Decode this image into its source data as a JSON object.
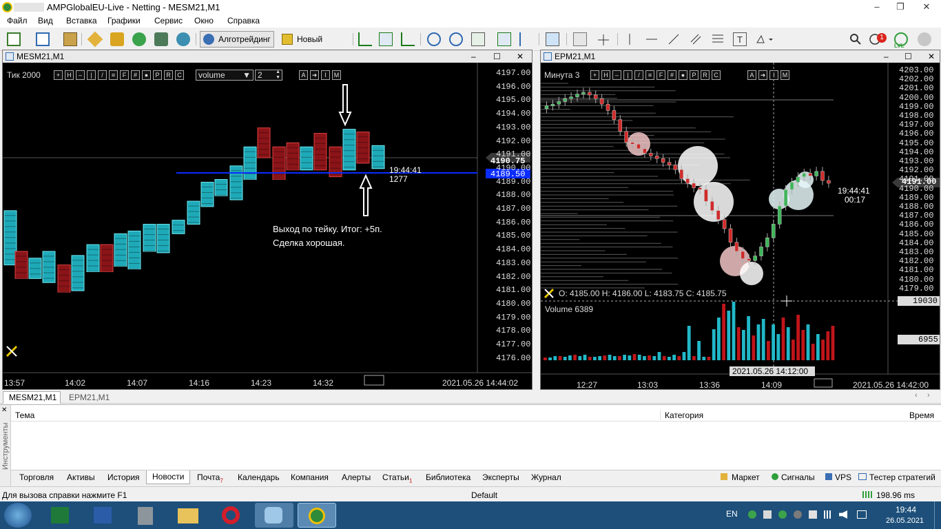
{
  "window": {
    "title": "AMPGlobalEU-Live - Netting - MESM21,M1",
    "minimize": "–",
    "restore": "❐",
    "close": "✕"
  },
  "menu": [
    "Файл",
    "Вид",
    "Вставка",
    "Графики",
    "Сервис",
    "Окно",
    "Справка"
  ],
  "toolbar": {
    "algotrading": "Алготрейдинг",
    "new_order": "Новый ордер",
    "lvl": "LVL",
    "badge": "1"
  },
  "left_chart": {
    "title": "MESM21,M1",
    "timeframe": "Тик 2000",
    "indicator": "volume",
    "param": "2",
    "tools": [
      "A",
      "➜",
      "I",
      "M"
    ],
    "price_ticks": [
      "4197.00",
      "4196.00",
      "4195.00",
      "4194.00",
      "4193.00",
      "4192.00",
      "4191.00",
      "4190.00",
      "4189.00",
      "4188.00",
      "4187.00",
      "4186.00",
      "4185.00",
      "4184.00",
      "4183.00",
      "4182.00",
      "4181.00",
      "4180.00",
      "4179.00",
      "4178.00",
      "4177.00",
      "4176.00"
    ],
    "current_price": "4190.75",
    "blue_price": "4189.50",
    "timer": "19:44:41",
    "timer_volume": "1277",
    "annotation_line1": "Выход по тейку. Итог: +5п.",
    "annotation_line2": "Сделка хорошая.",
    "time_ticks": [
      "13:57",
      "14:02",
      "14:07",
      "14:16",
      "14:23",
      "14:32"
    ],
    "datetime": "2021.05.26 14:44:02"
  },
  "right_chart": {
    "title": "EPM21,M1",
    "timeframe": "Минута 3",
    "tools": [
      "A",
      "➜",
      "I",
      "M"
    ],
    "price_ticks": [
      "4203.00",
      "4202.00",
      "4201.00",
      "4200.00",
      "4199.00",
      "4198.00",
      "4197.00",
      "4196.00",
      "4195.00",
      "4194.00",
      "4193.00",
      "4192.00",
      "4191.00",
      "4190.00",
      "4189.00",
      "4188.00",
      "4187.00",
      "4186.00",
      "4185.00",
      "4184.00",
      "4183.00",
      "4182.00",
      "4181.00",
      "4180.00",
      "4179.00"
    ],
    "current_price": "4191.00",
    "timer": "19:44:41",
    "timer_sub": "00:17",
    "ohlc": "O: 4185.00  H: 4186.00  L: 4183.75  C: 4185.75",
    "volume_label": "Volume 6389",
    "vol_ticks": [
      "19030",
      "6955"
    ],
    "crosshair_time": "2021.05.26 14:12:00",
    "time_ticks": [
      "12:27",
      "13:03",
      "13:36",
      "14:09"
    ],
    "datetime": "2021.05.26 14:42:00"
  },
  "chart_tabs": [
    "MESM21,M1",
    "EPM21,M1"
  ],
  "news_table": {
    "columns": [
      "Тема",
      "Категория",
      "Время"
    ],
    "side_label": "Инструменты"
  },
  "bottom_tabs": [
    {
      "label": "Торговля"
    },
    {
      "label": "Активы"
    },
    {
      "label": "История"
    },
    {
      "label": "Новости"
    },
    {
      "label": "Почта",
      "badge": "7"
    },
    {
      "label": "Календарь"
    },
    {
      "label": "Компания"
    },
    {
      "label": "Алерты"
    },
    {
      "label": "Статьи",
      "badge": "1"
    },
    {
      "label": "Библиотека"
    },
    {
      "label": "Эксперты"
    },
    {
      "label": "Журнал"
    }
  ],
  "bottom_right": [
    "Маркет",
    "Сигналы",
    "VPS",
    "Тестер стратегий"
  ],
  "status": {
    "help": "Для вызова справки нажмите F1",
    "profile": "Default",
    "ping": "198.96 ms"
  },
  "taskbar": {
    "lang": "EN",
    "time": "19:44",
    "date": "26.05.2021"
  },
  "colors": {
    "bull": "#21b8c8",
    "bear": "#c0151a",
    "blue_line": "#0a2cff",
    "bubble": "#ffffff"
  }
}
